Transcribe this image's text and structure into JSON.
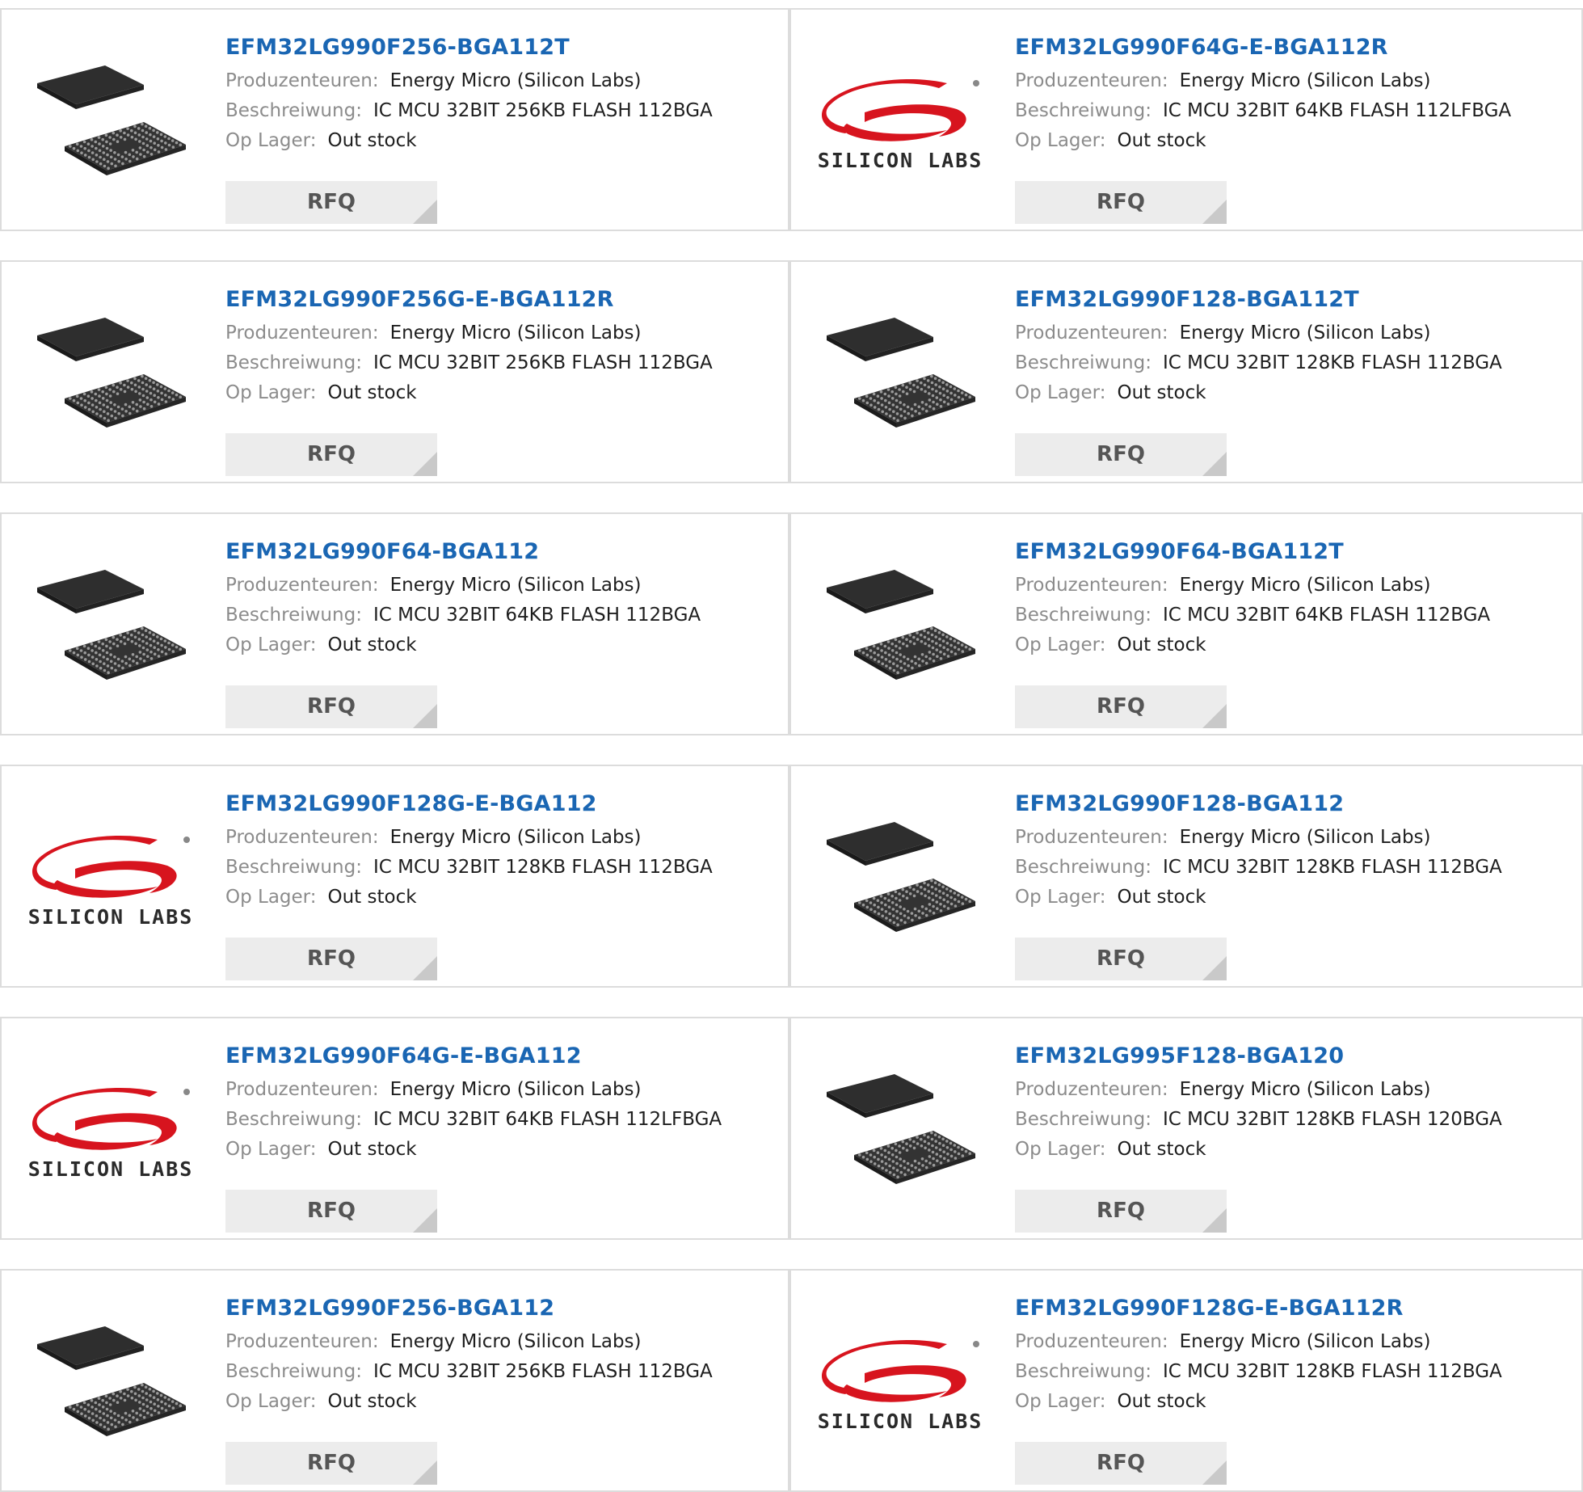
{
  "labels": {
    "manufacturer": "Produzenteuren:",
    "description": "Beschreiwung:",
    "stock": "Op Lager:",
    "rfq": "RFQ"
  },
  "brand": {
    "logo_text": "SILICON LABS",
    "logo_color": "#d7141e"
  },
  "colors": {
    "part_link": "#1a66b3",
    "card_border": "#dcdcdc",
    "button_bg": "#ececec"
  },
  "products": [
    {
      "part": "EFM32LG990F256-BGA112T",
      "manufacturer": "Energy Micro (Silicon Labs)",
      "description": "IC MCU 32BIT 256KB FLASH 112BGA",
      "stock": "Out stock",
      "image": "bga-chip-icon"
    },
    {
      "part": "EFM32LG990F64G-E-BGA112R",
      "manufacturer": "Energy Micro (Silicon Labs)",
      "description": "IC MCU 32BIT 64KB FLASH 112LFBGA",
      "stock": "Out stock",
      "image": "silicon-labs-logo"
    },
    {
      "part": "EFM32LG990F256G-E-BGA112R",
      "manufacturer": "Energy Micro (Silicon Labs)",
      "description": "IC MCU 32BIT 256KB FLASH 112BGA",
      "stock": "Out stock",
      "image": "bga-chip-icon"
    },
    {
      "part": "EFM32LG990F128-BGA112T",
      "manufacturer": "Energy Micro (Silicon Labs)",
      "description": "IC MCU 32BIT 128KB FLASH 112BGA",
      "stock": "Out stock",
      "image": "bga-chip-icon"
    },
    {
      "part": "EFM32LG990F64-BGA112",
      "manufacturer": "Energy Micro (Silicon Labs)",
      "description": "IC MCU 32BIT 64KB FLASH 112BGA",
      "stock": "Out stock",
      "image": "bga-chip-icon"
    },
    {
      "part": "EFM32LG990F64-BGA112T",
      "manufacturer": "Energy Micro (Silicon Labs)",
      "description": "IC MCU 32BIT 64KB FLASH 112BGA",
      "stock": "Out stock",
      "image": "bga-chip-icon"
    },
    {
      "part": "EFM32LG990F128G-E-BGA112",
      "manufacturer": "Energy Micro (Silicon Labs)",
      "description": "IC MCU 32BIT 128KB FLASH 112BGA",
      "stock": "Out stock",
      "image": "silicon-labs-logo"
    },
    {
      "part": "EFM32LG990F128-BGA112",
      "manufacturer": "Energy Micro (Silicon Labs)",
      "description": "IC MCU 32BIT 128KB FLASH 112BGA",
      "stock": "Out stock",
      "image": "bga-chip-icon"
    },
    {
      "part": "EFM32LG990F64G-E-BGA112",
      "manufacturer": "Energy Micro (Silicon Labs)",
      "description": "IC MCU 32BIT 64KB FLASH 112LFBGA",
      "stock": "Out stock",
      "image": "silicon-labs-logo"
    },
    {
      "part": "EFM32LG995F128-BGA120",
      "manufacturer": "Energy Micro (Silicon Labs)",
      "description": "IC MCU 32BIT 128KB FLASH 120BGA",
      "stock": "Out stock",
      "image": "bga-chip-icon"
    },
    {
      "part": "EFM32LG990F256-BGA112",
      "manufacturer": "Energy Micro (Silicon Labs)",
      "description": "IC MCU 32BIT 256KB FLASH 112BGA",
      "stock": "Out stock",
      "image": "bga-chip-icon"
    },
    {
      "part": "EFM32LG990F128G-E-BGA112R",
      "manufacturer": "Energy Micro (Silicon Labs)",
      "description": "IC MCU 32BIT 128KB FLASH 112BGA",
      "stock": "Out stock",
      "image": "silicon-labs-logo"
    }
  ]
}
